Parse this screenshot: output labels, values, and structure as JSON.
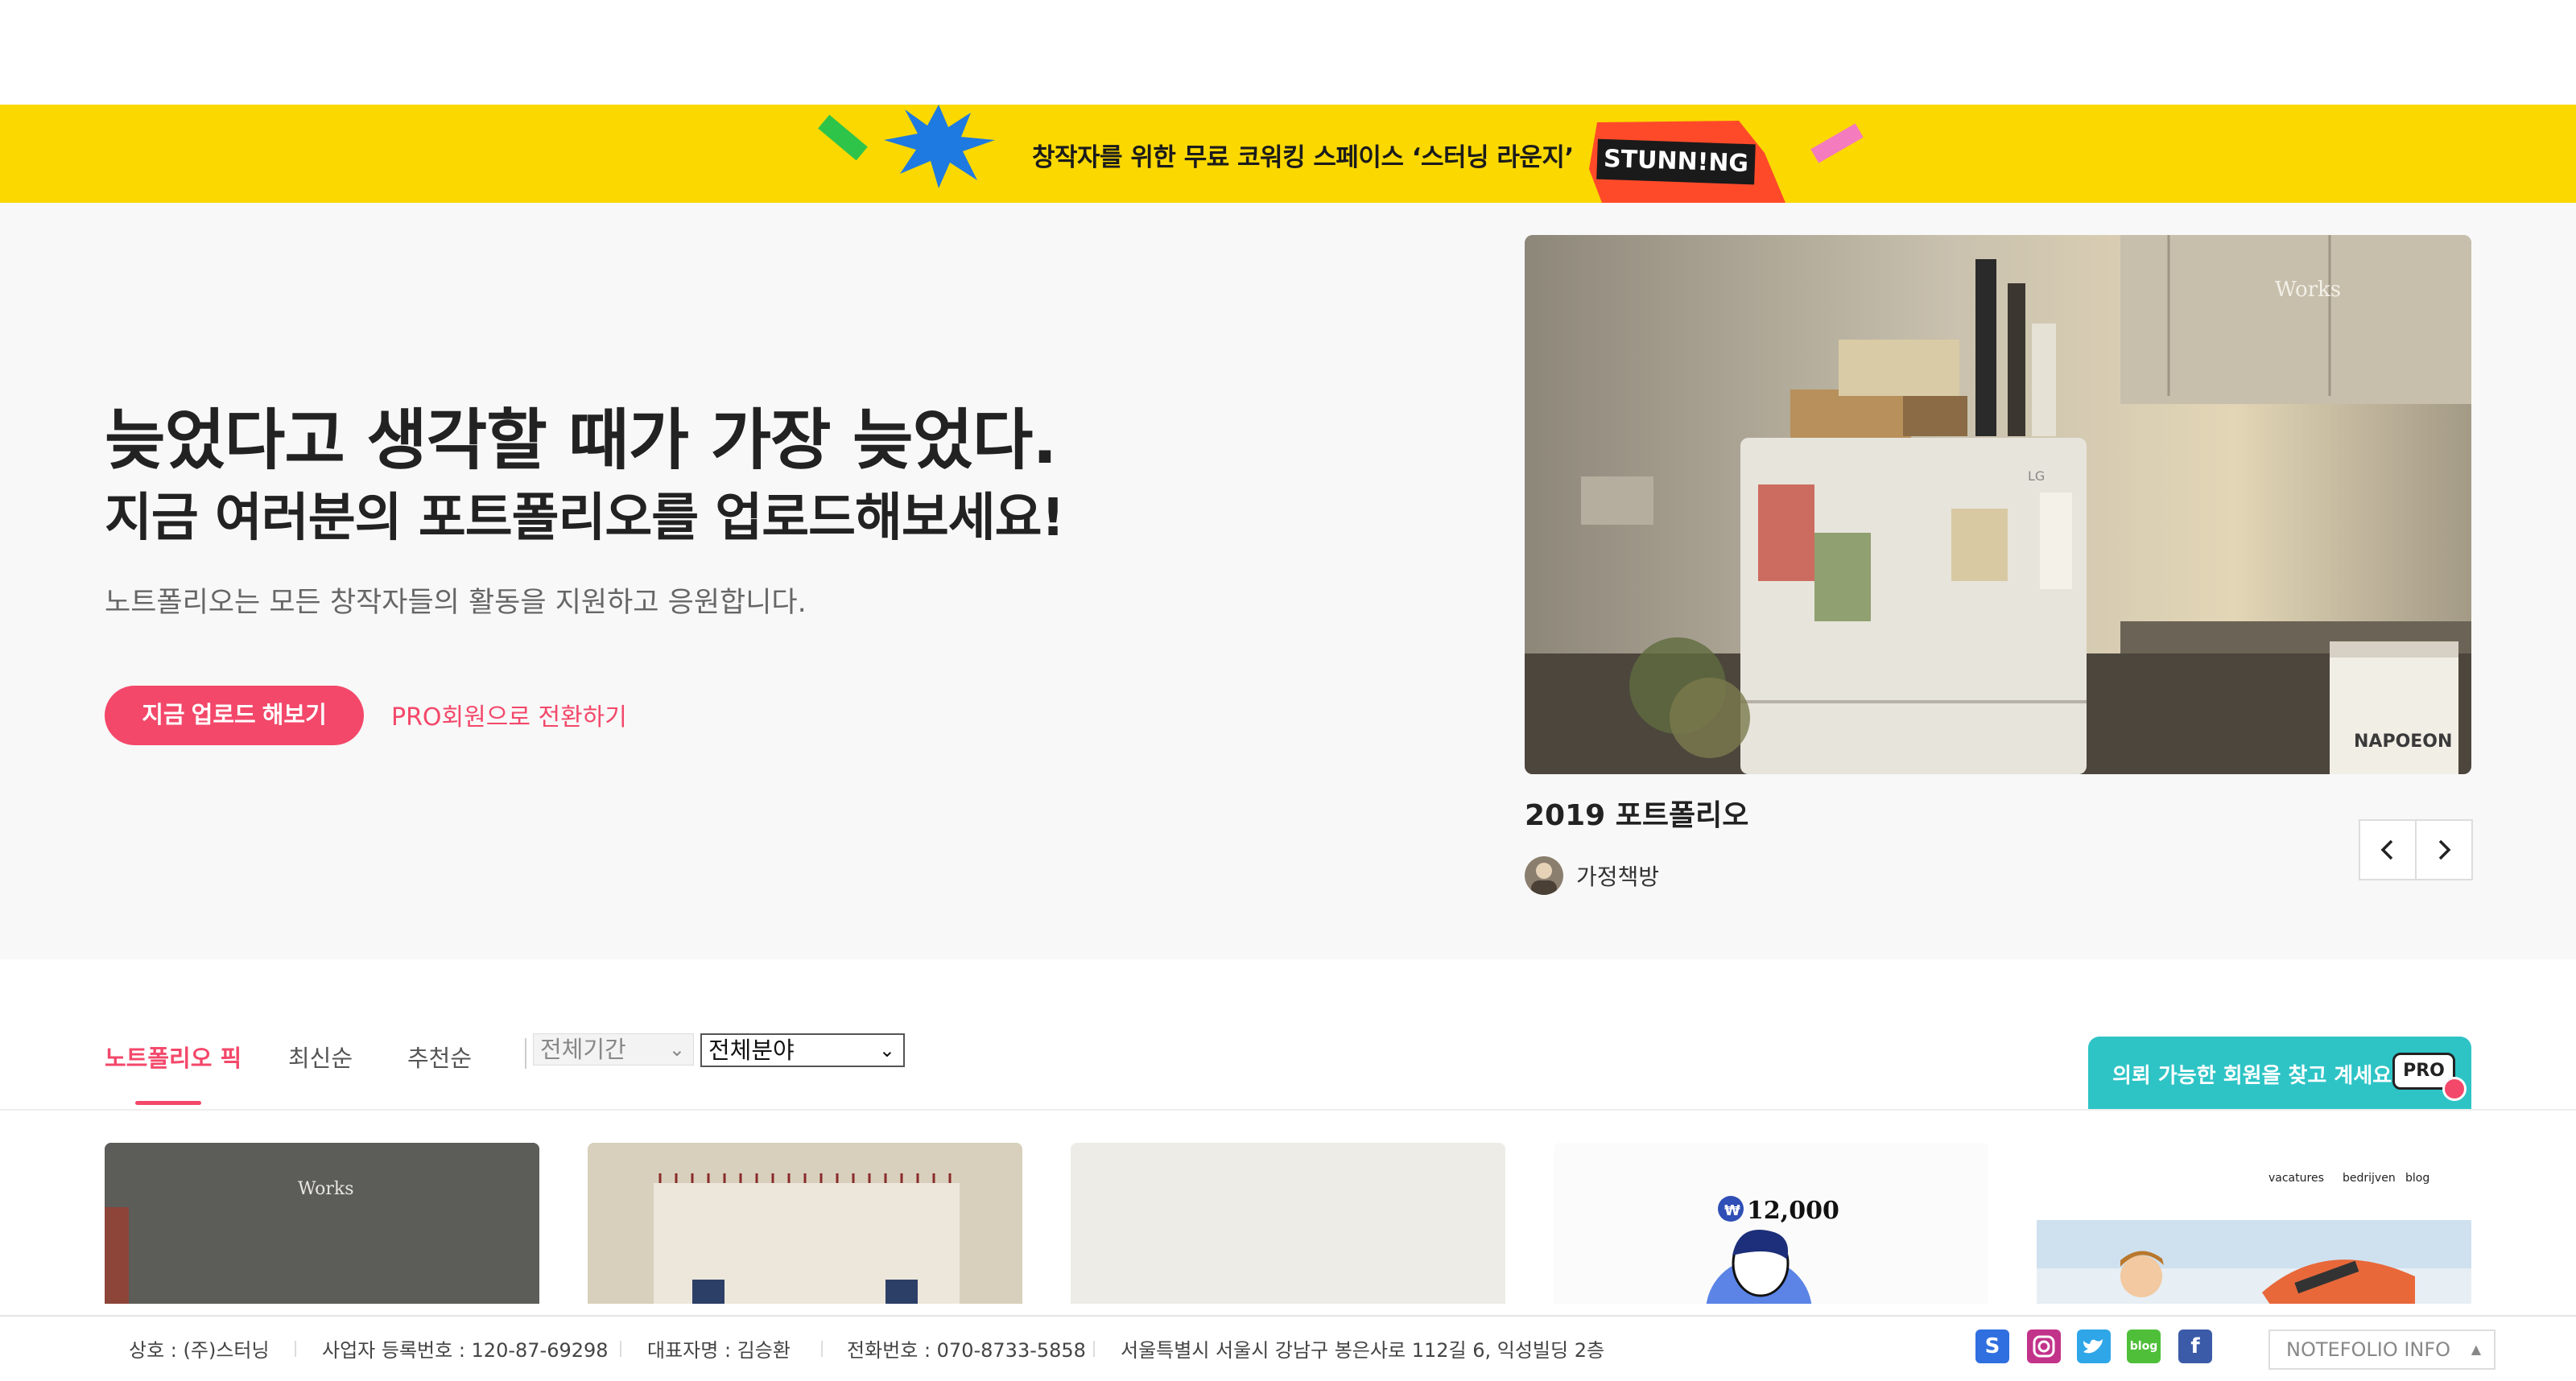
{
  "banner": {
    "text": "창작자를 위한 무료 코워킹 스페이스 ‘스터닝 라운지’",
    "logo_text": "STUNN!NG",
    "colors": {
      "background": "#fbd800",
      "logo_bg": "#ff4a2a",
      "star": "#1e7ae0",
      "green": "#2ec44a",
      "pink": "#f47bbd"
    }
  },
  "hero": {
    "title_line1": "늦었다고 생각할 때가 가장 늦었다.",
    "title_line2": "지금 여러분의 포트폴리오를 업로드해보세요!",
    "subtitle": "노트폴리오는 모든 창작자들의 활동을 지원하고 응원합니다.",
    "upload_button": "지금 업로드 해보기",
    "pro_link": "PRO회원으로 전환하기",
    "accent_color": "#f3486a"
  },
  "featured": {
    "image_label": "Works",
    "fridge_brand": "LG",
    "bag_text": "NAPOEON",
    "title": "2019 포트폴리오",
    "author": "가정책방",
    "prev_icon": "chevron-left-icon",
    "next_icon": "chevron-right-icon"
  },
  "tabs": {
    "items": [
      {
        "label": "노트폴리오 픽",
        "active": true
      },
      {
        "label": "최신순",
        "active": false
      },
      {
        "label": "추천순",
        "active": false
      }
    ],
    "period_select": "전체기간",
    "field_select": "전체분야"
  },
  "pro_finder": {
    "text": "의뢰 가능한 회원을 찾고 계세요?",
    "badge": "PRO",
    "color": "#2ec4c6"
  },
  "cards": {
    "card1_label": "Works",
    "card4_price": "12,000",
    "card4_currency": "₩",
    "card5_nav": [
      "vacatures",
      "bedrijven",
      "blog"
    ]
  },
  "footer": {
    "company": "상호 : (주)스터닝",
    "business_no": "사업자 등록번호 : 120-87-69298",
    "ceo": "대표자명 : 김승환",
    "phone": "전화번호 : 070-8733-5858",
    "address": "서울특별시 서울시 강남구 봉은사로 112길 6, 익성빌딩 2층",
    "social_icons": [
      "stunning-icon",
      "instagram-icon",
      "twitter-icon",
      "blog-icon",
      "facebook-icon"
    ],
    "blog_label": "blog",
    "info_button": "NOTEFOLIO INFO"
  }
}
